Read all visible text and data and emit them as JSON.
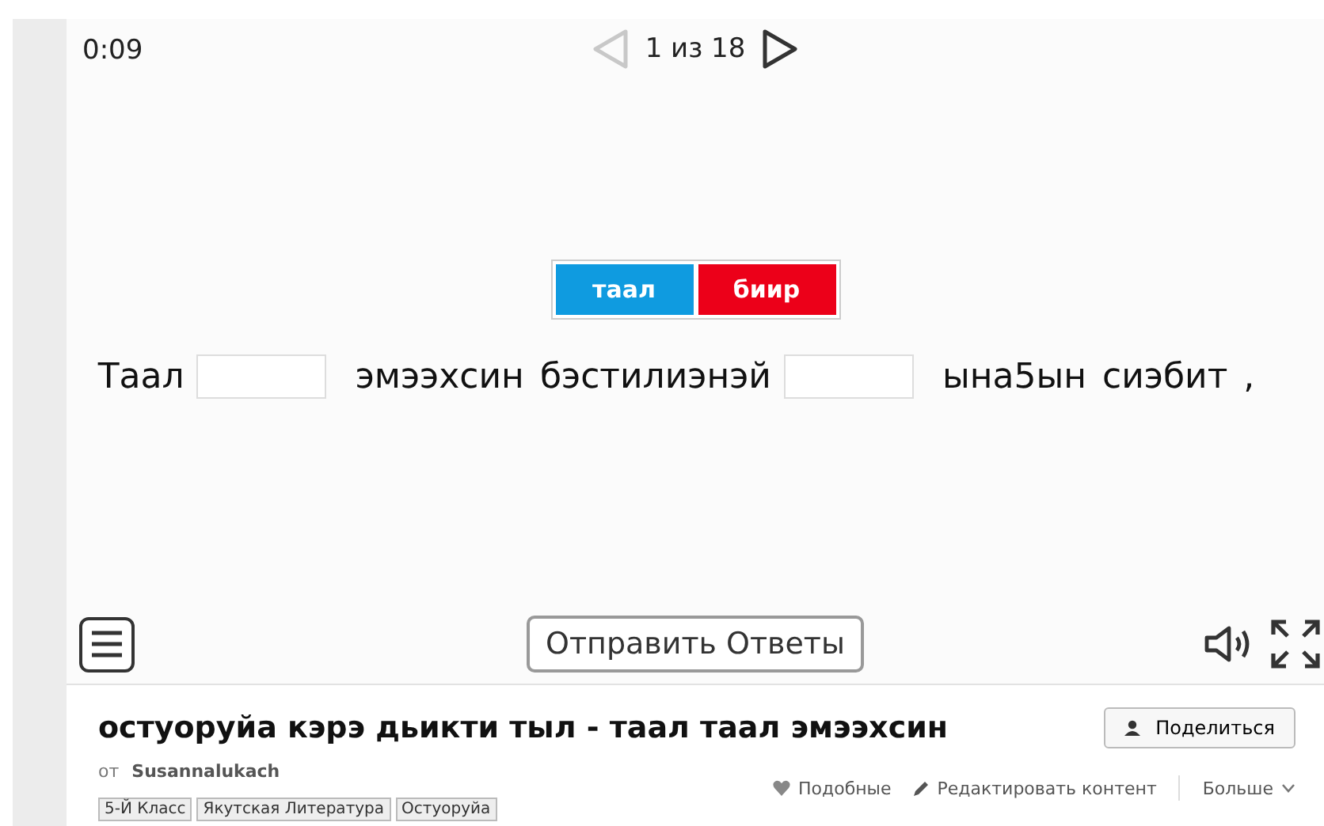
{
  "game": {
    "timer": "0:09",
    "pager": {
      "text": "1 из 18",
      "prev_disabled": true,
      "next_disabled": false
    },
    "options": [
      {
        "label": "таал",
        "color": "#0f9be0"
      },
      {
        "label": "биир",
        "color": "#ec0019"
      }
    ],
    "sentence": [
      {
        "kind": "word",
        "text": "Таал"
      },
      {
        "kind": "blank"
      },
      {
        "kind": "word",
        "text": "эмээхсин"
      },
      {
        "kind": "word",
        "text": "бэстилиэнэй"
      },
      {
        "kind": "blank"
      },
      {
        "kind": "word",
        "text": "ына5ын"
      },
      {
        "kind": "word",
        "text": "сиэбит"
      },
      {
        "kind": "word",
        "text": ","
      }
    ],
    "submit": "Отправить Ответы"
  },
  "info": {
    "title": "остуоруйа кэрэ дьикти тыл - таал таал эмээхсин",
    "share": "Поделиться",
    "by_label": "от",
    "author": "Susannalukach",
    "links": [
      "Подобные",
      "Редактировать контент"
    ],
    "more": "Больше",
    "tags": [
      "5-Й Класс",
      "Якутская Литература",
      "Остуоруйа"
    ]
  }
}
